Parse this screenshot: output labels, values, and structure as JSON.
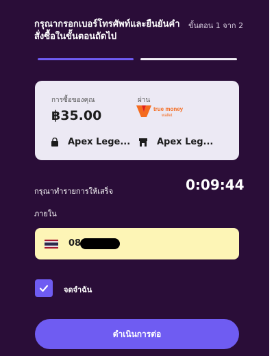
{
  "header": {
    "title": "กรุณากรอกเบอร์โทรศัพท์และยืนยันคำสั่งซื้อในขั้นตอนถัดไป",
    "step": "ขั้นตอน 1 จาก 2"
  },
  "progress": {
    "current_step": 1,
    "total_steps": 2
  },
  "order_card": {
    "purchase_label": "การซื้อของคุณ",
    "amount": "฿35.00",
    "via_label": "ผ่าน",
    "payment_brand": "true money",
    "payment_sub": "wallet",
    "product_name": "Apex Lege...",
    "store_name": "Apex Leg..."
  },
  "timer": {
    "prompt": "กรุณาทำรายการให้เสร็จภายใน",
    "countdown": "0:09:44"
  },
  "phone": {
    "country": "TH",
    "value": "08"
  },
  "remember": {
    "checked": true,
    "label": "จดจำฉัน"
  },
  "cta": {
    "label": "ดำเนินการต่อ"
  },
  "colors": {
    "background": "#2a0d38",
    "accent": "#6f5cf2",
    "card": "#ece9f4",
    "phone_field": "#fdf5b6",
    "brand_orange": "#f46b1f"
  }
}
